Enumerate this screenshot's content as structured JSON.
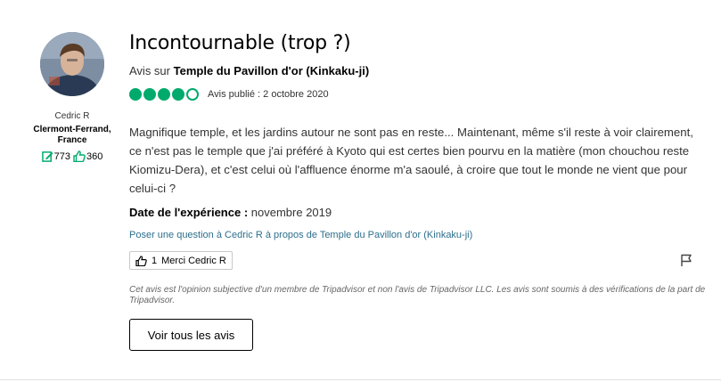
{
  "reviewer": {
    "name": "Cedric R",
    "location": "Clermont-Ferrand, France",
    "contributions": "773",
    "helpful_votes": "360"
  },
  "review": {
    "title": "Incontournable (trop ?)",
    "about_prefix": "Avis sur",
    "place_name": "Temple du Pavillon d'or (Kinkaku-ji)",
    "rating": 4,
    "rating_max": 5,
    "published": "Avis publié : 2 octobre 2020",
    "body": "Magnifique temple, et les jardins autour ne sont pas en reste... Maintenant, même s'il reste à voir clairement, ce n'est pas le temple que j'ai préféré à Kyoto qui est certes bien pourvu en la matière (mon chouchou reste Kiomizu-Dera), et c'est celui où l'affluence énorme m'a saoulé, à croire que tout le monde ne vient que pour celui-ci ?",
    "experience_label": "Date de l'expérience :",
    "experience_date": "novembre 2019"
  },
  "actions": {
    "ask_question": "Poser une question à Cedric R à propos de Temple du Pavillon d'or (Kinkaku-ji)",
    "thanks_count": "1",
    "thanks_label": "Merci Cedric R",
    "see_all_reviews": "Voir tous les avis"
  },
  "disclaimer": "Cet avis est l'opinion subjective d'un membre de Tripadvisor et non l'avis de Tripadvisor LLC. Les avis sont soumis à des vérifications de la part de Tripadvisor.",
  "colors": {
    "bubble_green": "#00aa6c",
    "link_blue": "#2d6f8c"
  },
  "icons": {
    "contributions": "edit-icon",
    "helpful": "thumbs-up-icon",
    "report": "flag-icon"
  }
}
